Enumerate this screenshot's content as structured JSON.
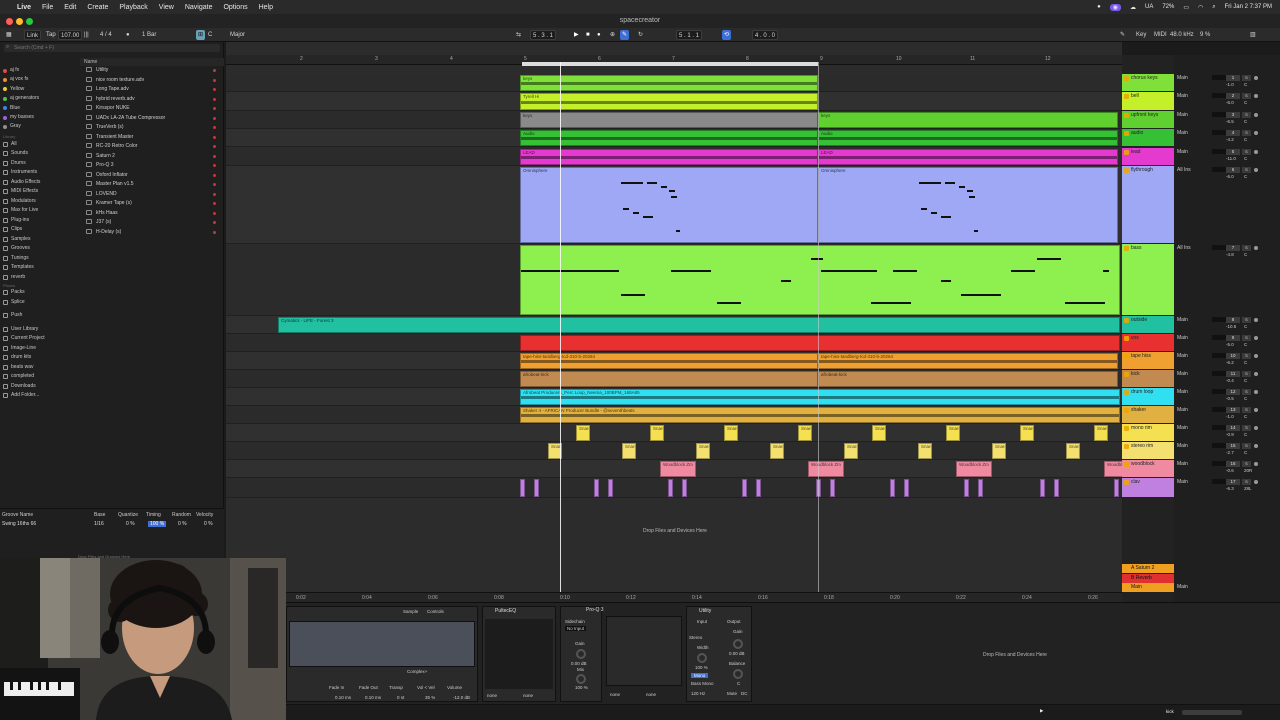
{
  "menubar": {
    "app": "Live",
    "items": [
      "File",
      "Edit",
      "Create",
      "Playback",
      "View",
      "Navigate",
      "Options",
      "Help"
    ],
    "status": {
      "battery": "72%",
      "lang": "UA",
      "clock": "Fri Jan 2  7:37 PM"
    }
  },
  "window": {
    "title": "spacecreator"
  },
  "control": {
    "link": "Link",
    "tap": "Tap",
    "tempo": "107.00",
    "nudge": "|||",
    "sig": "4 / 4",
    "metro": "●",
    "quant": "1 Bar",
    "key_root": "C",
    "key_scale": "Major",
    "position": "5 . 3 . 1",
    "loop_start": "5 . 1 . 1",
    "loop_len": "4 . 0 . 0",
    "key_label": "Key",
    "midi_label": "MIDI",
    "sample_rate": "48.0 kHz",
    "cpu": "9 %"
  },
  "browser": {
    "search_placeholder": "Search (Cmd + F)",
    "collections": [
      {
        "label": "aj fx",
        "color": "#e24848"
      },
      {
        "label": "aj vox fx",
        "color": "#e8902a"
      },
      {
        "label": "Yellow",
        "color": "#e8d02a"
      },
      {
        "label": "aj generators",
        "color": "#4ec04e"
      },
      {
        "label": "Blue",
        "color": "#3d84e6"
      },
      {
        "label": "my basses",
        "color": "#a060e0"
      },
      {
        "label": "Gray",
        "color": "#909090"
      }
    ],
    "library_head": "Library",
    "library": [
      "All",
      "Sounds",
      "Drums",
      "Instruments",
      "Audio Effects",
      "MIDI Effects",
      "Modulators",
      "Max for Live",
      "Plug-ins",
      "Clips",
      "Samples",
      "Grooves",
      "Tunings",
      "Templates",
      "reverb"
    ],
    "places_head": "Places",
    "places": [
      "Packs",
      "Splice",
      "Push",
      "User Library",
      "Current Project",
      "Image-Line",
      "drum kits",
      "beats wav",
      "completed",
      "Downloads",
      "Add Folder..."
    ],
    "name_header": "Name",
    "files": [
      "Utility",
      "nice room texture.adv",
      "Long Tape.adv",
      "hybrid reverb.adv",
      "Kirsspor NUKE",
      "UADx LA-2A Tube Compressor",
      "TrueVerb (s)",
      "Transient Master",
      "RC-20 Retro Color",
      "Saturn 2",
      "Pro-Q 3",
      "Oxford Inflator",
      "Master Plan v1.5",
      "LOVEND",
      "Kramer Tape (s)",
      "kHs Haas",
      "J37 (s)",
      "H-Delay (s)"
    ]
  },
  "groove": {
    "headers": [
      "Groove Name",
      "Base",
      "Quantize",
      "Timing",
      "Random",
      "Velocity"
    ],
    "row": {
      "name": "Swing 16ths 66",
      "base": "1/16",
      "quantize": "0 %",
      "timing": "100 %",
      "random": "0 %",
      "velocity": "0 %"
    },
    "drop_hint": "Drop Files and Grooves Here"
  },
  "ruler_bars": [
    "2",
    "3",
    "4",
    "5",
    "6",
    "7",
    "8",
    "9",
    "10",
    "11",
    "12"
  ],
  "time_ruler": [
    "0:02",
    "0:04",
    "0:06",
    "0:08",
    "0:10",
    "0:12",
    "0:14",
    "0:16",
    "0:18",
    "0:20",
    "0:22",
    "0:24",
    "0:26"
  ],
  "tracks": [
    {
      "name": "chorus keys",
      "color": "#7fe03a",
      "io": "Main",
      "num": "1",
      "vol": "-1.0",
      "pan": "C"
    },
    {
      "name": "bell",
      "color": "#c4f02a",
      "io": "Main",
      "num": "2",
      "vol": "-6.0",
      "pan": "C"
    },
    {
      "name": "upfront keys",
      "color": "#5fd030",
      "io": "Main",
      "num": "3",
      "vol": "-6.5",
      "pan": "C"
    },
    {
      "name": "audio",
      "color": "#35c035",
      "io": "Main",
      "num": "4",
      "vol": "-4.2",
      "pan": "C"
    },
    {
      "name": "lead",
      "color": "#e43ad0",
      "io": "Main",
      "num": "5",
      "vol": "-11.0",
      "pan": "C"
    },
    {
      "name": "flythrough",
      "color": "#9ea8f4",
      "io": "All Ins",
      "num": "6",
      "vol": "-6.0",
      "pan": "C"
    },
    {
      "name": "bass",
      "color": "#8ef04e",
      "io": "All Ins",
      "num": "7",
      "vol": "-4.8",
      "pan": "C"
    },
    {
      "name": "outside",
      "color": "#20c0a0",
      "io": "Main",
      "num": "8",
      "vol": "-10.5",
      "pan": "C"
    },
    {
      "name": "vox",
      "color": "#e83030",
      "io": "Main",
      "num": "9",
      "vol": "-5.0",
      "pan": "C"
    },
    {
      "name": "tape hiss",
      "color": "#f0a030",
      "io": "Main",
      "num": "10",
      "vol": "-6.2",
      "pan": "C"
    },
    {
      "name": "kick",
      "color": "#c08a50",
      "io": "Main",
      "num": "11",
      "vol": "-0.4",
      "pan": "C"
    },
    {
      "name": "drum loop",
      "color": "#30e0f0",
      "io": "Main",
      "num": "12",
      "vol": "-0.5",
      "pan": "C"
    },
    {
      "name": "shaker",
      "color": "#e0b040",
      "io": "Main",
      "num": "13",
      "vol": "-1.0",
      "pan": "C"
    },
    {
      "name": "mono rim",
      "color": "#f4e050",
      "io": "Main",
      "num": "14",
      "vol": "-0.9",
      "pan": "C"
    },
    {
      "name": "stereo rim",
      "color": "#f4e070",
      "io": "Main",
      "num": "15",
      "vol": "-2.7",
      "pan": "C"
    },
    {
      "name": "woodblock",
      "color": "#f08aa0",
      "io": "Main",
      "num": "16",
      "vol": "-0.6",
      "pan": "20R"
    },
    {
      "name": "clav",
      "color": "#c080e0",
      "io": "Main",
      "num": "17",
      "vol": "-6.3",
      "pan": "28L"
    }
  ],
  "clips": {
    "keys": "keys",
    "tyrellh": "Tyrell Hi",
    "keys2": "keys",
    "audio": "Audio",
    "lead": "LEAD",
    "omni": "Omnisphere",
    "outside": "Cymatics - LIFE - Forest 3",
    "tape": "tape-hiss-tandberg-tcd-310-b-20264",
    "kick": "afrobeat-kick",
    "drumloop": "Afrobeat Producers_Perc Loop_Neema_100BPM_168A85",
    "shaker": "Shaker 4 - AFRICAN Producer Bundle - @seventhbeats",
    "rim": "Snare",
    "wood": "Woodblock Zm",
    "drop": "Drop Files and Devices Here"
  },
  "returns": [
    {
      "name": "A Saturn 2",
      "color": "#f0a020"
    },
    {
      "name": "B Reverb",
      "color": "#e03030"
    },
    {
      "name": "Main",
      "color": "#f0a020"
    }
  ],
  "devices": {
    "simpler": {
      "tabs": [
        "Sample",
        "Controls"
      ],
      "fade_in": "Fade In",
      "fade_out": "Fade Out",
      "transp": "Transp",
      "vol_vel": "Vol < Vel",
      "volume": "Volume",
      "fade_in_v": "0.10 ms",
      "fade_out_v": "0.10 ms",
      "transp_v": "0 st",
      "vol_vel_v": "35 %",
      "volume_v": "-12.0 dB",
      "mode": "Complex+"
    },
    "pultec": "PultecEQ",
    "proq": "Pro-Q 3",
    "proq_sidechain": "Sidechain",
    "proq_noinput": "No Input",
    "proq_gain": "Gain",
    "proq_gain_v": "0.00 dB",
    "proq_mix": "Mix",
    "proq_mix_v": "100 %",
    "utility": "Utility",
    "util_input": "Input",
    "util_output": "Output",
    "util_stereo": "Stereo",
    "util_width": "Width",
    "util_width_v": "100 %",
    "util_mono": "Mono",
    "util_bass_mono": "Bass Mono",
    "util_freq": "120 Hz",
    "util_gain": "Gain",
    "util_gain_v": "0.00 dB",
    "util_balance": "Balance",
    "util_balance_v": "C",
    "util_mute": "Mute",
    "util_dc": "DC",
    "none": "none"
  },
  "status": {
    "track": "kick"
  }
}
